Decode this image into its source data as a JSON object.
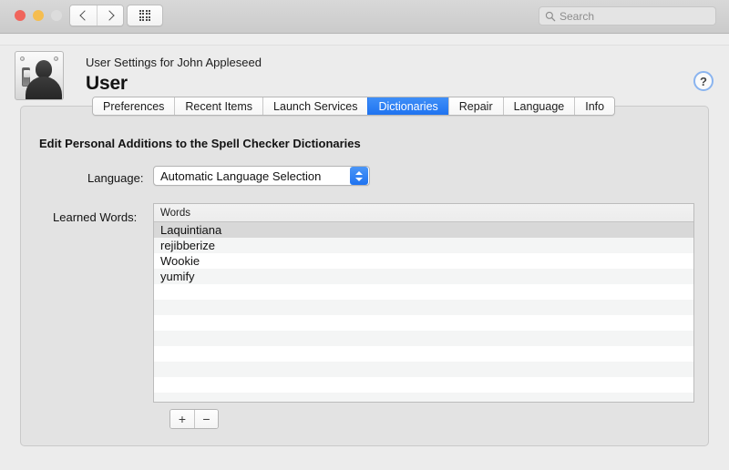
{
  "window": {
    "traffic_lights": [
      "close",
      "minimize",
      "zoom"
    ],
    "nav": {
      "back_label": "Back",
      "forward_label": "Forward",
      "grid_label": "All Settings"
    },
    "search": {
      "placeholder": "Search",
      "value": "",
      "icon": "search-icon"
    }
  },
  "header": {
    "subtitle": "User Settings for John Appleseed",
    "title": "User",
    "icon": "user-panel-icon",
    "help_label": "?"
  },
  "tabs": [
    {
      "label": "Preferences",
      "selected": false
    },
    {
      "label": "Recent Items",
      "selected": false
    },
    {
      "label": "Launch Services",
      "selected": false
    },
    {
      "label": "Dictionaries",
      "selected": true
    },
    {
      "label": "Repair",
      "selected": false
    },
    {
      "label": "Language",
      "selected": false
    },
    {
      "label": "Info",
      "selected": false
    }
  ],
  "main": {
    "section_heading": "Edit Personal Additions to the Spell Checker Dictionaries",
    "language": {
      "label": "Language:",
      "selected": "Automatic Language Selection"
    },
    "learned_words": {
      "label": "Learned Words:",
      "column_header": "Words",
      "rows": [
        {
          "word": "Laquintiana",
          "selected": true
        },
        {
          "word": "rejibberize",
          "selected": false
        },
        {
          "word": "Wookie",
          "selected": false
        },
        {
          "word": "yumify",
          "selected": false
        },
        {
          "word": "",
          "selected": false
        },
        {
          "word": "",
          "selected": false
        },
        {
          "word": "",
          "selected": false
        },
        {
          "word": "",
          "selected": false
        },
        {
          "word": "",
          "selected": false
        },
        {
          "word": "",
          "selected": false
        },
        {
          "word": "",
          "selected": false
        },
        {
          "word": "",
          "selected": false
        }
      ]
    },
    "add_button_label": "+",
    "remove_button_label": "−"
  },
  "colors": {
    "accent_blue": "#2a7ff5",
    "panel_bg": "#e3e3e3",
    "window_bg": "#ececec",
    "row_alt": "#f4f5f5",
    "row_selected": "#d8d8d8",
    "traffic_close": "#f0655c",
    "traffic_min": "#f5bd4f",
    "traffic_zoom": "#dcdcdc"
  }
}
